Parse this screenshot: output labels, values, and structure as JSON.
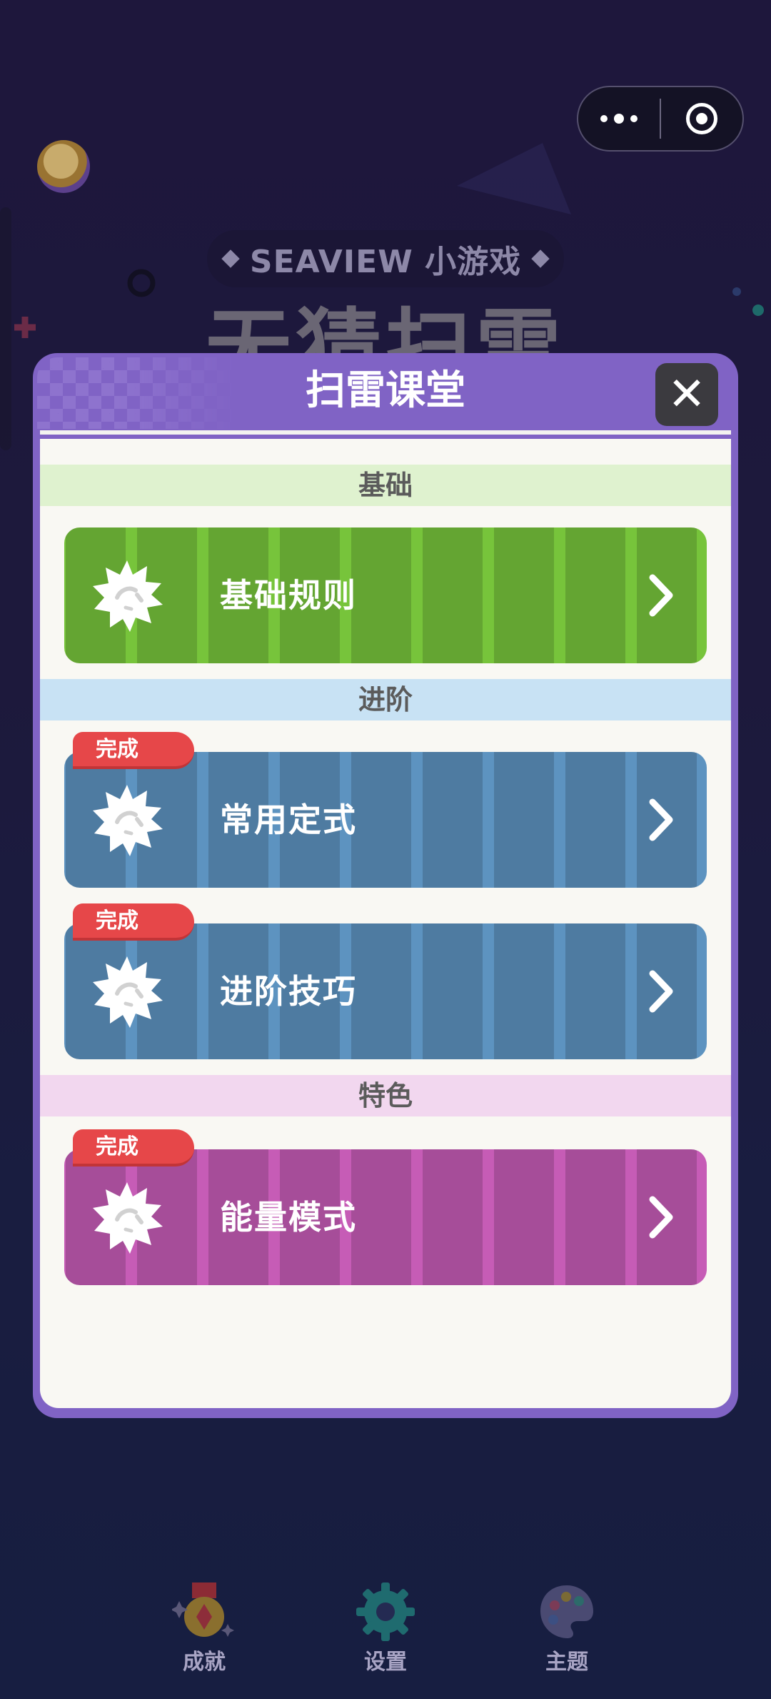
{
  "brand": {
    "text": "SEAVIEW 小游戏"
  },
  "game": {
    "title": "无猜扫雷"
  },
  "modal": {
    "title": "扫雷课堂",
    "close_label": "✕",
    "sections": [
      {
        "title": "基础",
        "color": "#dff2cf"
      },
      {
        "title": "进阶",
        "color": "#c8e2f4"
      },
      {
        "title": "特色",
        "color": "#f2d7ef"
      }
    ],
    "lessons": [
      {
        "label": "基础规则",
        "color": "#77c43b",
        "completed": false
      },
      {
        "label": "常用定式",
        "color": "#5d93c0",
        "completed": true
      },
      {
        "label": "进阶技巧",
        "color": "#5d93c0",
        "completed": true
      },
      {
        "label": "能量模式",
        "color": "#c65cb6",
        "completed": true
      }
    ],
    "completed_badge": "完成"
  },
  "nav": {
    "items": [
      {
        "label": "成就",
        "icon": "medal-icon"
      },
      {
        "label": "设置",
        "icon": "gear-icon"
      },
      {
        "label": "主题",
        "icon": "palette-icon"
      }
    ]
  },
  "icons": {
    "menu": "more-dots-icon",
    "close_mini": "target-icon",
    "lesson": "mine-icon",
    "chevron": "chevron-right-icon"
  }
}
